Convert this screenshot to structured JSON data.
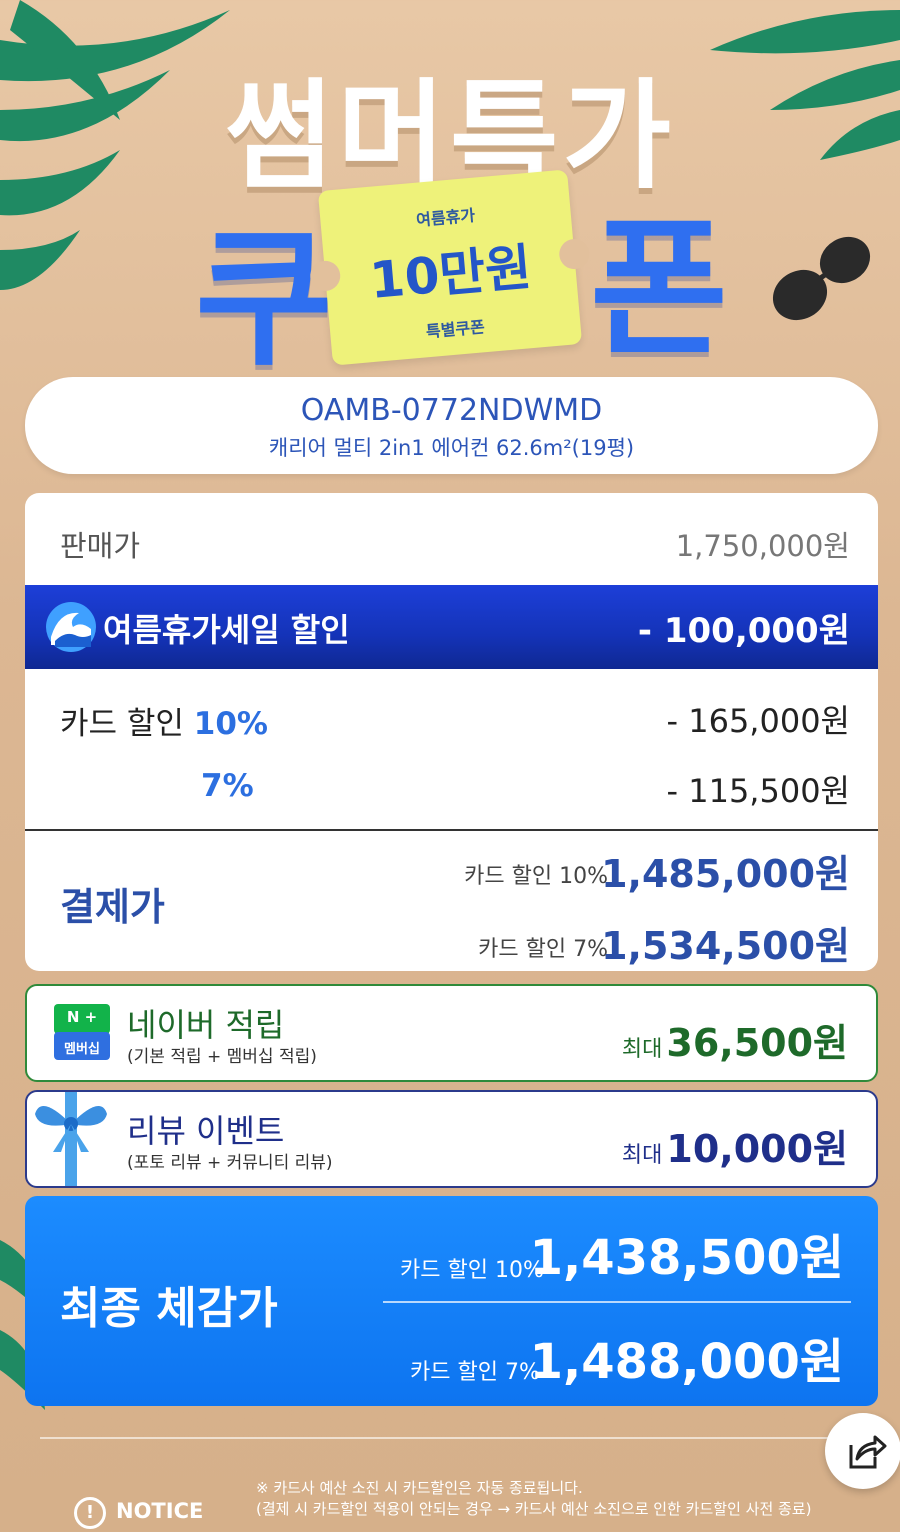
{
  "hero": {
    "title": "썸머특가",
    "coupon_left": "쿠",
    "coupon_right": "폰",
    "ticket_top": "여름휴가",
    "ticket_amount": "10만원",
    "ticket_bottom": "특별쿠폰"
  },
  "product": {
    "code": "OAMB-0772NDWMD",
    "name": "캐리어 멀티 2in1 에어컨 62.6m²(19평)"
  },
  "price": {
    "sale_label": "판매가",
    "sale_value": "1,750,000원",
    "summer_label": "여름휴가세일 할인",
    "summer_value": "- 100,000원",
    "card_label": "카드 할인",
    "card_pct10": "10%",
    "card_pct7": "7%",
    "card_value10": "- 165,000원",
    "card_value7": "- 115,500원",
    "pay_label": "결제가",
    "pay_sub10": "카드 할인 10%",
    "pay_value10": "1,485,000원",
    "pay_sub7": "카드 할인 7%",
    "pay_value7": "1,534,500원"
  },
  "naver": {
    "badge_top": "N +",
    "badge_bottom": "멤버십",
    "title": "네이버 적립",
    "sub": "(기본 적립 + 멤버십 적립)",
    "max_label": "최대",
    "value": "36,500원"
  },
  "review": {
    "title": "리뷰 이벤트",
    "sub": "(포토 리뷰 + 커뮤니티 리뷰)",
    "max_label": "최대",
    "value": "10,000원"
  },
  "final": {
    "label": "최종 체감가",
    "sub10": "카드 할인 10%",
    "value10": "1,438,500원",
    "sub7": "카드 할인 7%",
    "value7": "1,488,000원"
  },
  "notice": {
    "label": "NOTICE",
    "line1": "※ 카드사 예산 소진 시 카드할인은 자동 종료됩니다.",
    "line2": "(결제 시 카드할인 적용이 안되는 경우 → 카드사 예산 소진으로 인한 카드할인 사전 종료)"
  },
  "colors": {
    "accent_blue": "#2c55b8",
    "summer_bar": "#1433b8",
    "naver_green": "#1e6a2a",
    "final_blue": "#0d74f0"
  },
  "icons": [
    "palm-leaf-icon",
    "sunglasses-icon",
    "wave-icon",
    "naver-plus-icon",
    "gift-ribbon-icon",
    "notice-icon",
    "share-icon"
  ]
}
